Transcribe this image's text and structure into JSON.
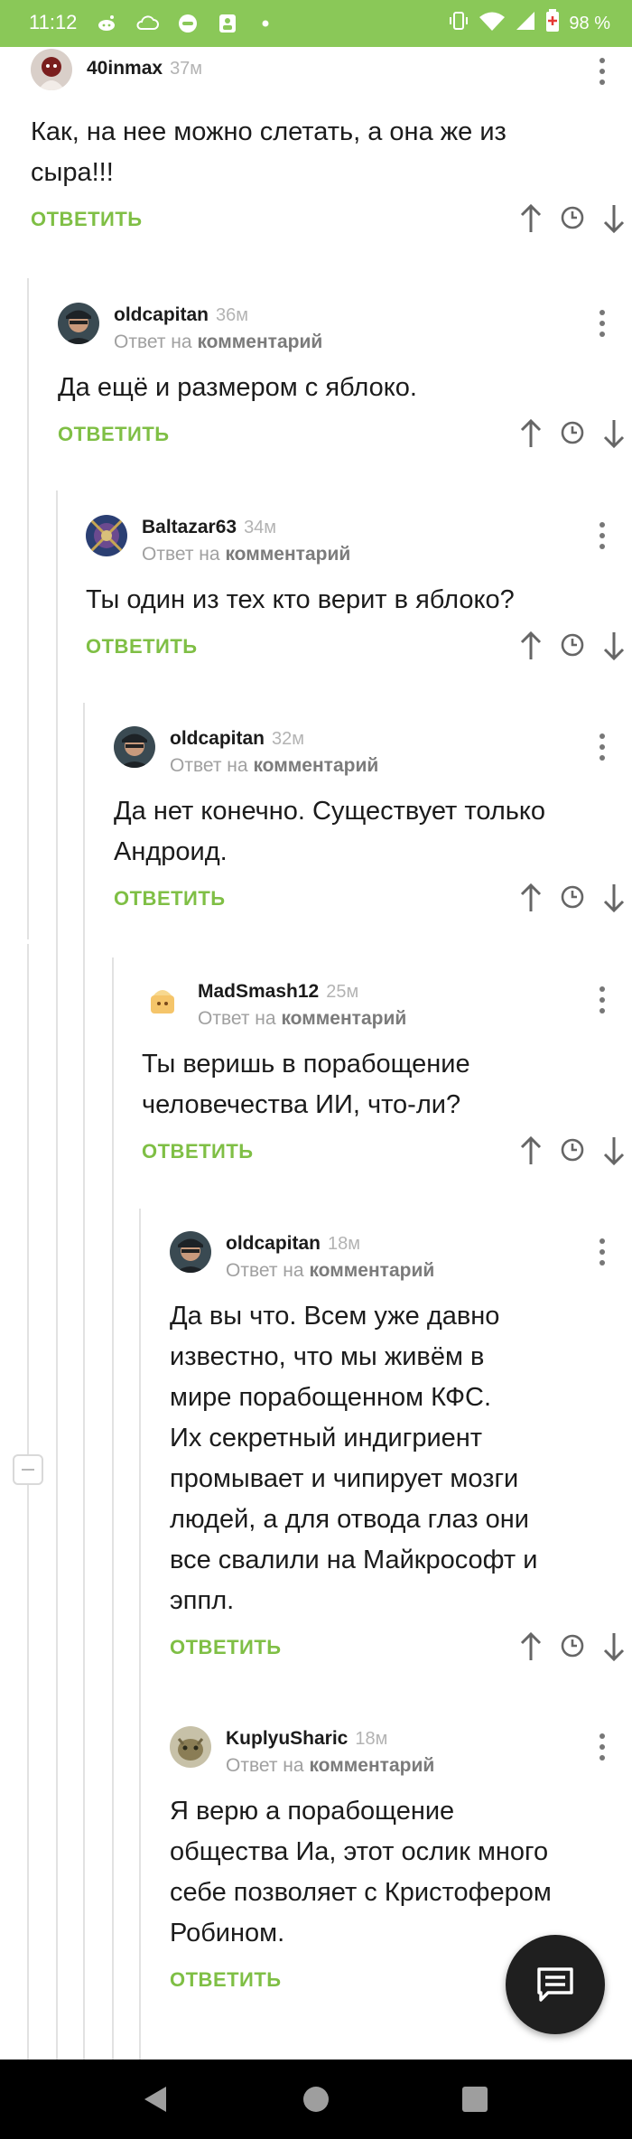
{
  "status_bar": {
    "time": "11:12",
    "battery": "98 %",
    "background": "#8ac858",
    "notification_icons": [
      "reddit-alien-icon",
      "cloud-icon",
      "chat-bubble-icon",
      "person-icon",
      "dot-icon"
    ],
    "system_icons": [
      "vibrate-icon",
      "wifi-icon",
      "signal-icon",
      "battery-icon"
    ]
  },
  "ui": {
    "reply_label": "ОТВЕТИТЬ",
    "reply_to_prefix": "Ответ на",
    "reply_to_link": "комментарий",
    "accent_green": "#7fbf45"
  },
  "comments": [
    {
      "user": "40inmax",
      "time": "37м",
      "is_reply": false,
      "text_lines": [
        "Как, на нее можно слетать, а она же из",
        "сыра!!!"
      ]
    },
    {
      "user": "oldcapitan",
      "time": "36м",
      "is_reply": true,
      "text_lines": [
        "Да ещё и размером с яблоко."
      ]
    },
    {
      "user": "Baltazar63",
      "time": "34м",
      "is_reply": true,
      "text_lines": [
        "Ты один из тех кто верит в яблоко?"
      ]
    },
    {
      "user": "oldcapitan",
      "time": "32м",
      "is_reply": true,
      "text_lines": [
        "Да нет конечно. Существует только",
        "Андроид."
      ]
    },
    {
      "user": "MadSmash12",
      "time": "25м",
      "is_reply": true,
      "text_lines": [
        "Ты веришь в порабощение",
        "человечества ИИ, что-ли?"
      ]
    },
    {
      "user": "oldcapitan",
      "time": "18м",
      "is_reply": true,
      "text_lines": [
        "Да вы что. Всем уже давно",
        "известно, что мы живём в",
        "мире порабощенном КФС.",
        "Их секретный индигриент",
        "промывает и чипирует мозги",
        "людей, а для отвода глаз они",
        "все свалили на Майкрософт и",
        "эппл."
      ]
    },
    {
      "user": "KuplyuSharic",
      "time": "18м",
      "is_reply": true,
      "text_lines": [
        "Я верю а порабощение",
        "общества Иа, этот ослик много",
        "себе позволяет с Кристофером",
        "Робином."
      ]
    }
  ],
  "fab": {
    "icon": "comment-icon"
  },
  "nav_bar": {
    "buttons": [
      "back-icon",
      "home-icon",
      "recents-icon"
    ]
  }
}
